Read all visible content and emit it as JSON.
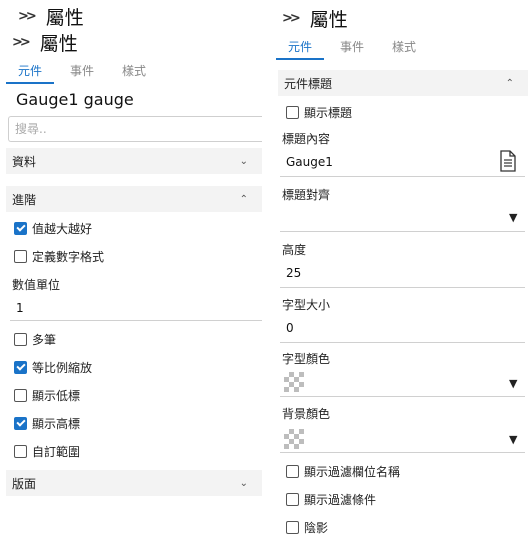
{
  "left": {
    "header_top": "屬性",
    "header": "屬性",
    "tabs": [
      "元件",
      "事件",
      "樣式"
    ],
    "component_name": "Gauge1 gauge",
    "search_placeholder": "搜尋..",
    "sections": {
      "data": "資料",
      "advanced": "進階",
      "layout": "版面"
    },
    "checkboxes": [
      {
        "label": "值越大越好",
        "checked": true
      },
      {
        "label": "定義數字格式",
        "checked": false
      }
    ],
    "unit_label": "數值單位",
    "unit_value": "1",
    "checkboxes2": [
      {
        "label": "多筆",
        "checked": false
      },
      {
        "label": "等比例縮放",
        "checked": true
      },
      {
        "label": "顯示低標",
        "checked": false
      },
      {
        "label": "顯示高標",
        "checked": true
      },
      {
        "label": "自訂範圍",
        "checked": false
      }
    ]
  },
  "right": {
    "header": "屬性",
    "tabs": [
      "元件",
      "事件",
      "樣式"
    ],
    "section_title": "元件標題",
    "show_title": {
      "label": "顯示標題",
      "checked": false
    },
    "title_content_label": "標題內容",
    "title_content_value": "Gauge1",
    "title_align_label": "標題對齊",
    "height_label": "高度",
    "height_value": "25",
    "font_size_label": "字型大小",
    "font_size_value": "0",
    "font_color_label": "字型顏色",
    "bg_color_label": "背景顏色",
    "bottom_checks": [
      {
        "label": "顯示過濾欄位名稱",
        "checked": false
      },
      {
        "label": "顯示過濾條件",
        "checked": false
      },
      {
        "label": "陰影",
        "checked": false
      }
    ]
  },
  "icons": {
    "expand": "double-chevron-right-icon",
    "collapse": "chevron-down-icon",
    "doc": "document-icon"
  },
  "colors": {
    "accent": "#1a73c8",
    "section_bg": "#f3f3f3"
  }
}
